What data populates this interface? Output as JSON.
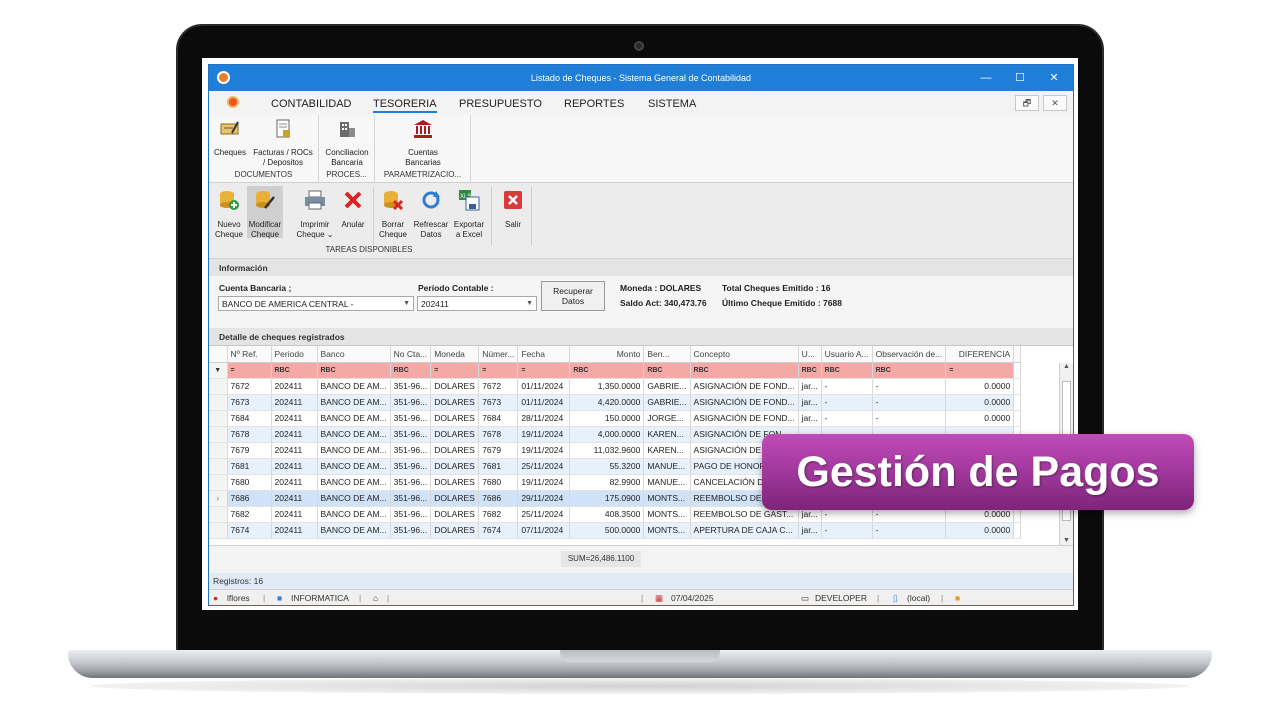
{
  "window": {
    "title": "Listado de Cheques - Sistema General de Contabilidad",
    "minimize": "—",
    "maximize": "☐",
    "close": "✕"
  },
  "menu": {
    "items": [
      "CONTABILIDAD",
      "TESORERIA",
      "PRESUPUESTO",
      "REPORTES",
      "SISTEMA"
    ],
    "active": "TESORERIA"
  },
  "ribbon": {
    "documentos": {
      "label": "DOCUMENTOS",
      "cheques": "Cheques",
      "facturas_l1": "Facturas / ROCs",
      "facturas_l2": "/ Depositos"
    },
    "procesos": {
      "label": "PROCES...",
      "conciliacion_l1": "Conciliacion",
      "conciliacion_l2": "Bancaria"
    },
    "parametrizacion": {
      "label": "PARAMETRIZACIO...",
      "cuentas_l1": "Cuentas",
      "cuentas_l2": "Bancarias"
    }
  },
  "toolbar": {
    "nuevo_l1": "Nuevo",
    "nuevo_l2": "Cheque",
    "modificar_l1": "Modificar",
    "modificar_l2": "Cheque",
    "imprimir_l1": "Imprimir",
    "imprimir_l2": "Cheque",
    "anular": "Anular",
    "borrar_l1": "Borrar",
    "borrar_l2": "Cheque",
    "refrescar_l1": "Refrescar",
    "refrescar_l2": "Datos",
    "exportar_l1": "Exportar",
    "exportar_l2": "a Excel",
    "salir": "Salir",
    "group_label": "TAREAS DISPONIBLES"
  },
  "info": {
    "section": "Información",
    "cuenta_label": "Cuenta Bancaria ;",
    "cuenta_value": "BANCO DE AMERICA CENTRAL -",
    "periodo_label": "Período Contable :",
    "periodo_value": "202411",
    "recuperar_l1": "Recuperar",
    "recuperar_l2": "Datos",
    "moneda": "Moneda : DOLARES",
    "saldo": "Saldo Act: 340,473.76",
    "total": "Total Cheques Emitido : 16",
    "ultimo": "Último Cheque Emitido : 7688"
  },
  "detalle": {
    "section": "Detalle de cheques registrados",
    "columns": [
      "Nº Ref.",
      "Periodo",
      "Banco",
      "No Cta...",
      "Moneda",
      "Númer...",
      "Fecha",
      "Monto",
      "Ben...",
      "Concepto",
      "U...",
      "Usuario A...",
      "Observación de...",
      "DIFERENCIA"
    ],
    "filter_eq": "=",
    "filter_rbc": "RBC",
    "rows": [
      [
        "7672",
        "202411",
        "BANCO DE AM...",
        "351-96...",
        "DOLARES",
        "7672",
        "01/11/2024",
        "1,350.0000",
        "GABRIE...",
        "ASIGNACIÓN DE FOND...",
        "jar...",
        "-",
        "-",
        "0.0000"
      ],
      [
        "7673",
        "202411",
        "BANCO DE AM...",
        "351-96...",
        "DOLARES",
        "7673",
        "01/11/2024",
        "4,420.0000",
        "GABRIE...",
        "ASIGNACIÓN DE FOND...",
        "jar...",
        "-",
        "-",
        "0.0000"
      ],
      [
        "7684",
        "202411",
        "BANCO DE AM...",
        "351-96...",
        "DOLARES",
        "7684",
        "28/11/2024",
        "150.0000",
        "JORGE...",
        "ASIGNACIÓN DE FOND...",
        "jar...",
        "-",
        "-",
        "0.0000"
      ],
      [
        "7678",
        "202411",
        "BANCO DE AM...",
        "351-96...",
        "DOLARES",
        "7678",
        "19/11/2024",
        "4,000.0000",
        "KAREN...",
        "ASIGNACIÓN DE FON",
        "",
        "",
        "",
        ""
      ],
      [
        "7679",
        "202411",
        "BANCO DE AM...",
        "351-96...",
        "DOLARES",
        "7679",
        "19/11/2024",
        "11,032.9600",
        "KAREN...",
        "ASIGNACIÓN DE FON",
        "",
        "",
        "",
        ""
      ],
      [
        "7681",
        "202411",
        "BANCO DE AM...",
        "351-96...",
        "DOLARES",
        "7681",
        "25/11/2024",
        "55.3200",
        "MANUE...",
        "PAGO DE HONORAR",
        "",
        "",
        "",
        ""
      ],
      [
        "7680",
        "202411",
        "BANCO DE AM...",
        "351-96...",
        "DOLARES",
        "7680",
        "19/11/2024",
        "82.9900",
        "MANUE...",
        "CANCELACIÓN DE H",
        "",
        "",
        "",
        ""
      ],
      [
        "7686",
        "202411",
        "BANCO DE AM...",
        "351-96...",
        "DOLARES",
        "7686",
        "29/11/2024",
        "175.0900",
        "MONTS...",
        "REEMBOLSO DE GAS",
        "",
        "",
        "",
        ""
      ],
      [
        "7682",
        "202411",
        "BANCO DE AM...",
        "351-96...",
        "DOLARES",
        "7682",
        "25/11/2024",
        "408.3500",
        "MONTS...",
        "REEMBOLSO DE GAST...",
        "jar...",
        "-",
        "-",
        "0.0000"
      ],
      [
        "7674",
        "202411",
        "BANCO DE AM...",
        "351-96...",
        "DOLARES",
        "7674",
        "07/11/2024",
        "500.0000",
        "MONTS...",
        "APERTURA DE CAJA C...",
        "jar...",
        "-",
        "-",
        "0.0000"
      ]
    ],
    "sum": "SUM=26,486.1100",
    "registros": "Registros: 16"
  },
  "status": {
    "user": "lflores",
    "dept": "INFORMATICA",
    "date": "07/04/2025",
    "machine": "DEVELOPER",
    "db": "(local)"
  },
  "badge": "Gestión de Pagos",
  "colors": {
    "titlebar": "#1f7fd8",
    "filter_row": "#f5a9a6",
    "badge": "#a0389c"
  }
}
